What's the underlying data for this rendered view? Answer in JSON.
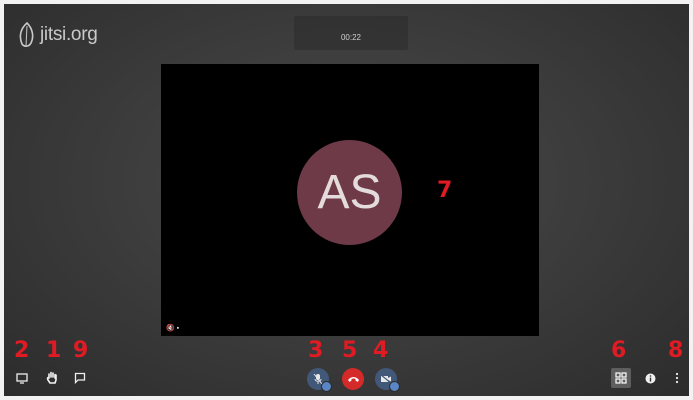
{
  "logo": {
    "text": "jitsi.org",
    "icon": "jitsi-leaf-icon"
  },
  "timer": {
    "value": "00:22"
  },
  "stage": {
    "avatar_initials": "AS",
    "avatar_color": "#6e3a48",
    "status_text": "🔇 ▪"
  },
  "annotations": {
    "n1": "1",
    "n2": "2",
    "n3": "3",
    "n4": "4",
    "n5": "5",
    "n6": "6",
    "n7": "7",
    "n8": "8",
    "n9": "9"
  },
  "toolbar": {
    "left": [
      "screen-share-icon",
      "raise-hand-icon",
      "chat-icon"
    ],
    "center": [
      "microphone-icon",
      "hangup-icon",
      "camera-icon"
    ],
    "right": [
      "tile-view-icon",
      "info-icon",
      "more-options-icon"
    ]
  },
  "colors": {
    "hangup": "#d42a2a",
    "device_button": "#425879",
    "annotation": "#e01b24"
  }
}
